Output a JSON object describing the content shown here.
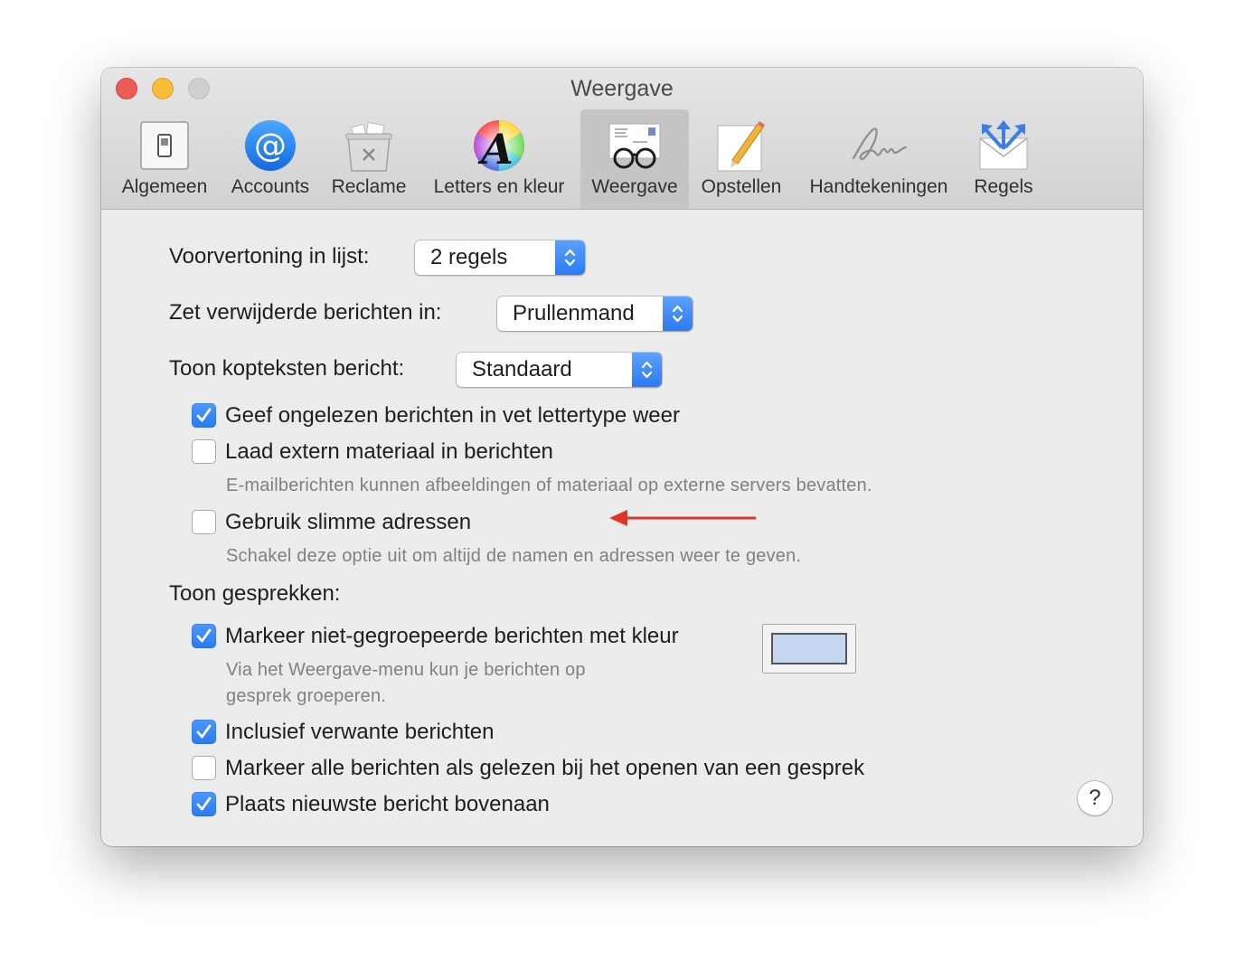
{
  "window": {
    "title": "Weergave"
  },
  "toolbar": {
    "tabs": [
      {
        "label": "Algemeen",
        "icon": "switch-icon"
      },
      {
        "label": "Accounts",
        "icon": "at-sign-icon"
      },
      {
        "label": "Reclame",
        "icon": "trash-bin-icon"
      },
      {
        "label": "Letters en kleur",
        "icon": "font-color-wheel-icon"
      },
      {
        "label": "Weergave",
        "icon": "glasses-envelope-icon",
        "selected": true
      },
      {
        "label": "Opstellen",
        "icon": "pencil-paper-icon"
      },
      {
        "label": "Handtekeningen",
        "icon": "signature-icon"
      },
      {
        "label": "Regels",
        "icon": "envelope-arrows-icon"
      }
    ]
  },
  "settings": {
    "preview": {
      "label": "Voorvertoning in lijst:",
      "value": "2 regels"
    },
    "deleted": {
      "label": "Zet verwijderde berichten in:",
      "value": "Prullenmand"
    },
    "headers": {
      "label": "Toon kopteksten bericht:",
      "value": "Standaard"
    },
    "bold_unread": {
      "label": "Geef ongelezen berichten in vet lettertype weer",
      "checked": true
    },
    "load_remote": {
      "label": "Laad extern materiaal in berichten",
      "checked": false,
      "hint": "E-mailberichten kunnen afbeeldingen of materiaal op externe servers bevatten."
    },
    "smart_addresses": {
      "label": "Gebruik slimme adressen",
      "checked": false,
      "hint": "Schakel deze optie uit om altijd de namen en adressen weer te geven."
    },
    "conversations": {
      "label": "Toon gesprekken:",
      "highlight": {
        "label": "Markeer niet-gegroepeerde berichten met kleur",
        "checked": true,
        "hint_line1": "Via het Weergave-menu kun je berichten op",
        "hint_line2": "gesprek groeperen.",
        "color": "#c5d6f0"
      },
      "include_related": {
        "label": "Inclusief verwante berichten",
        "checked": true
      },
      "mark_read": {
        "label": "Markeer alle berichten als gelezen bij het openen van een gesprek",
        "checked": false
      },
      "newest_top": {
        "label": "Plaats nieuwste bericht bovenaan",
        "checked": true
      }
    },
    "help_label": "?"
  },
  "annotation": {
    "arrow_color": "#e0342a"
  },
  "colors": {
    "accent": "#2a7af3",
    "window_bg": "#ececec",
    "close": "#ed5b56",
    "minimize": "#f6bd3a"
  }
}
